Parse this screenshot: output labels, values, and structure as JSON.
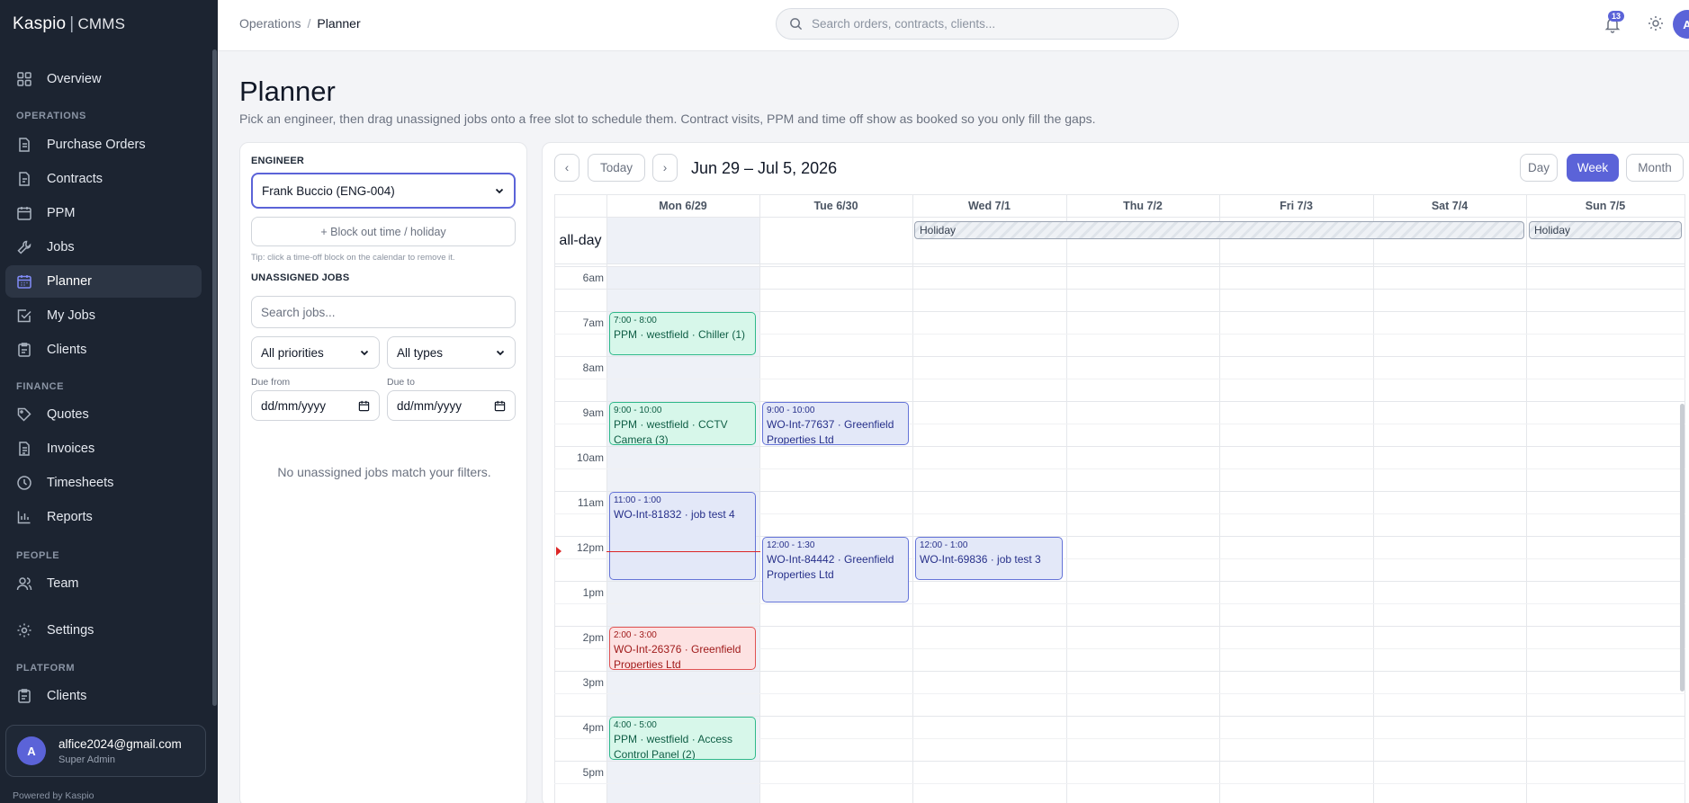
{
  "brand": {
    "name": "Kaspio",
    "product": "CMMS"
  },
  "sidebar": {
    "overview": "Overview",
    "sections": {
      "operations": "OPERATIONS",
      "finance": "FINANCE",
      "people": "PEOPLE",
      "platform": "PLATFORM"
    },
    "operations": [
      "Purchase Orders",
      "Contracts",
      "PPM",
      "Jobs",
      "Planner",
      "My Jobs",
      "Clients"
    ],
    "finance": [
      "Quotes",
      "Invoices",
      "Timesheets",
      "Reports"
    ],
    "people": [
      "Team"
    ],
    "settings": "Settings",
    "platform": [
      "Clients"
    ],
    "active": "Planner"
  },
  "user": {
    "initial": "A",
    "email": "alfice2024@gmail.com",
    "role": "Super Admin"
  },
  "footer": {
    "powered": "Powered by Kaspio"
  },
  "topbar": {
    "breadcrumb": [
      "Operations",
      "Planner"
    ],
    "search_placeholder": "Search orders, contracts, clients...",
    "notifications": "13",
    "avatar": "A"
  },
  "page": {
    "title": "Planner",
    "subtitle": "Pick an engineer, then drag unassigned jobs onto a free slot to schedule them. Contract visits, PPM and time off show as booked so you only fill the gaps."
  },
  "panel": {
    "engineer_label": "ENGINEER",
    "engineer_value": "Frank Buccio (ENG-004)",
    "block_button": "+ Block out time / holiday",
    "tip": "Tip: click a time-off block on the calendar to remove it.",
    "unassigned_label": "UNASSIGNED JOBS",
    "search_placeholder": "Search jobs...",
    "priority_value": "All priorities",
    "type_value": "All types",
    "due_from_label": "Due from",
    "due_to_label": "Due to",
    "date_placeholder": "dd/mm/yyyy",
    "empty": "No unassigned jobs match your filters."
  },
  "calendar": {
    "prev": "‹",
    "today": "Today",
    "next": "›",
    "range": "Jun 29 – Jul 5, 2026",
    "views": [
      "Day",
      "Week",
      "Month"
    ],
    "active_view": "Week",
    "days": [
      "Mon 6/29",
      "Tue 6/30",
      "Wed 7/1",
      "Thu 7/2",
      "Fri 7/3",
      "Sat 7/4",
      "Sun 7/5"
    ],
    "allday_label": "all-day",
    "holidays": [
      "Holiday",
      "Holiday"
    ],
    "hours": [
      "6am",
      "7am",
      "8am",
      "9am",
      "10am",
      "11am",
      "12pm",
      "1pm",
      "2pm",
      "3pm",
      "4pm",
      "5pm"
    ],
    "events": [
      {
        "time": "7:00 - 8:00",
        "title": "PPM · westfield · Chiller (1)"
      },
      {
        "time": "9:00 - 10:00",
        "title": "PPM · westfield · CCTV Camera (3)"
      },
      {
        "time": "9:00 - 10:00",
        "title": "WO-Int-77637 · Greenfield Properties Ltd"
      },
      {
        "time": "11:00 - 1:00",
        "title": "WO-Int-81832 · job test 4"
      },
      {
        "time": "12:00 - 1:30",
        "title": "WO-Int-84442 · Greenfield Properties Ltd"
      },
      {
        "time": "12:00 - 1:00",
        "title": "WO-Int-69836 · job test 3"
      },
      {
        "time": "2:00 - 3:00",
        "title": "WO-Int-26376 · Greenfield Properties Ltd"
      },
      {
        "time": "4:00 - 5:00",
        "title": "PPM · westfield · Access Control Panel (2)"
      }
    ]
  }
}
